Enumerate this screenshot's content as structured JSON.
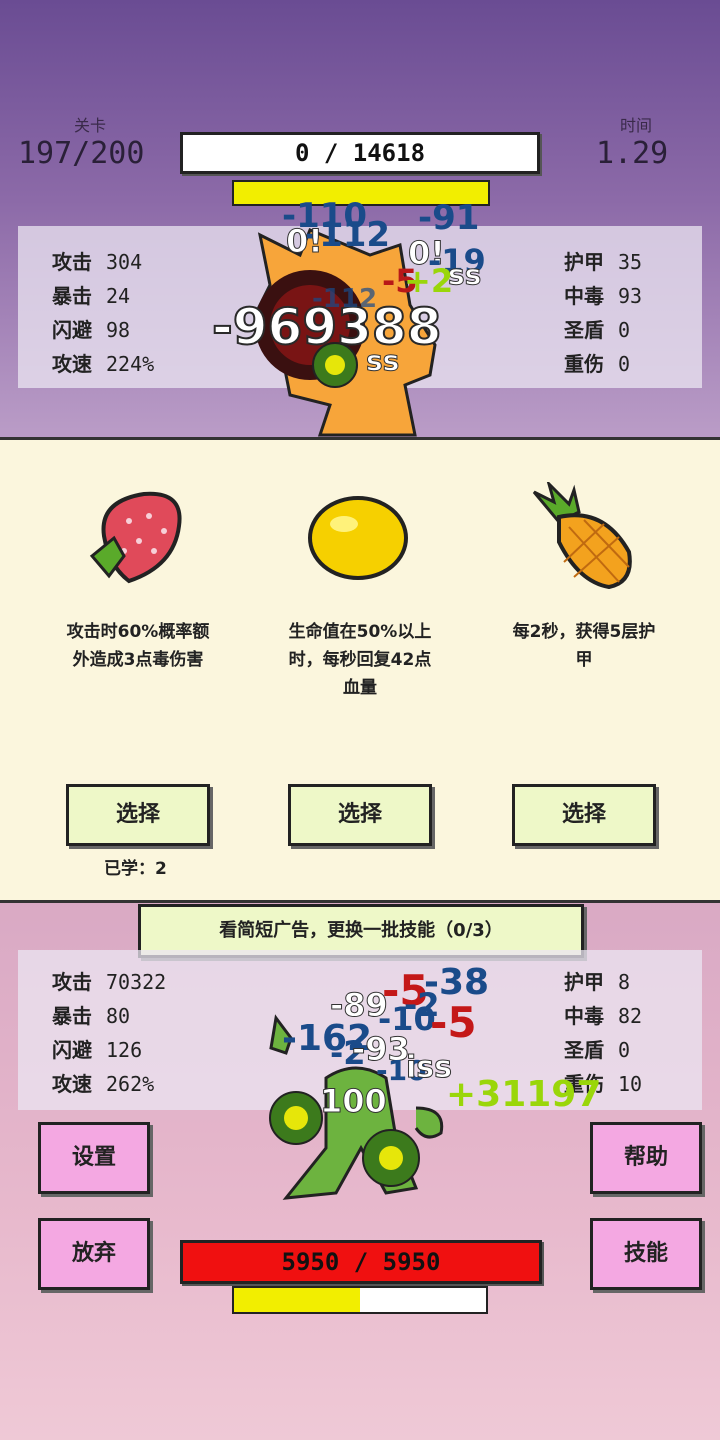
{
  "top": {
    "level_label": "关卡",
    "level_value": "197/200",
    "time_label": "时间",
    "time_value": "1.29",
    "enemy_hp": "0 / 14618"
  },
  "enemy_stats": {
    "left": [
      {
        "name": "攻击",
        "value": "304"
      },
      {
        "name": "暴击",
        "value": "24"
      },
      {
        "name": "闪避",
        "value": "98"
      },
      {
        "name": "攻速",
        "value": "224%"
      }
    ],
    "right": [
      {
        "name": "护甲",
        "value": "35"
      },
      {
        "name": "中毒",
        "value": "93"
      },
      {
        "name": "圣盾",
        "value": "0"
      },
      {
        "name": "重伤",
        "value": "0"
      }
    ]
  },
  "enemy_damage": [
    "-110",
    "-112",
    "-91",
    "0!",
    "0!",
    "-19",
    "ss",
    "-5",
    "+2",
    "-969388",
    "-112",
    "ss"
  ],
  "choices": [
    {
      "icon": "strawberry-icon",
      "desc": [
        "攻击时60%概率额",
        "外造成3点毒伤害"
      ],
      "button": "选择"
    },
    {
      "icon": "lemon-icon",
      "desc": [
        "生命值在50%以上",
        "时，每秒回复42点",
        "血量"
      ],
      "button": "选择"
    },
    {
      "icon": "pineapple-icon",
      "desc": [
        "每2秒，获得5层护",
        "甲"
      ],
      "button": "选择"
    }
  ],
  "learned": "已学：2",
  "ad_button": "看简短广告，更换一批技能（0/3）",
  "player_stats": {
    "left": [
      {
        "name": "攻击",
        "value": "70322"
      },
      {
        "name": "暴击",
        "value": "80"
      },
      {
        "name": "闪避",
        "value": "126"
      },
      {
        "name": "攻速",
        "value": "262%"
      }
    ],
    "right": [
      {
        "name": "护甲",
        "value": "8"
      },
      {
        "name": "中毒",
        "value": "82"
      },
      {
        "name": "圣盾",
        "value": "0"
      },
      {
        "name": "重伤",
        "value": "10"
      }
    ]
  },
  "player_damage": [
    "-89",
    "-5",
    "-38",
    "-10",
    "-2",
    "-5",
    "-162",
    "-2",
    "-93",
    "-10",
    "iss",
    "+31197",
    "100"
  ],
  "buttons": {
    "settings": "设置",
    "help": "帮助",
    "give_up": "放弃",
    "skills": "技能"
  },
  "player_hp": "5950 / 5950",
  "player_energy_fraction": 0.5,
  "colors": {
    "enemy_energy": "#f2ee00",
    "player_hp": "#f01010",
    "player_energy": "#f2ee00",
    "button_pink": "#f4a8e2",
    "select_button": "#eef8c8"
  }
}
